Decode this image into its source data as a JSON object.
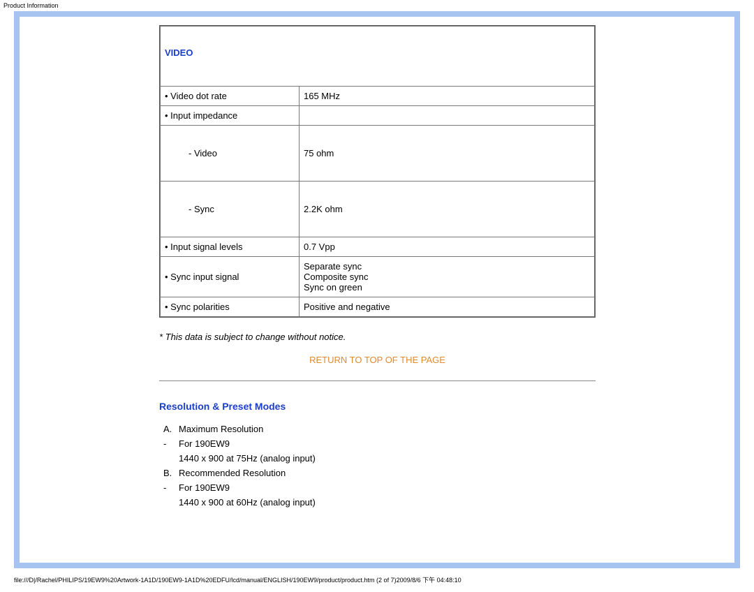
{
  "page": {
    "top_label": "Product Information",
    "footer_path": "file:///D|/Rachel/PHILIPS/19EW9%20Artwork-1A1D/190EW9-1A1D%20EDFU/lcd/manual/ENGLISH/190EW9/product/product.htm (2 of 7)2009/8/6 下午 04:48:10"
  },
  "video_section": {
    "heading": "VIDEO",
    "rows": {
      "dot_rate_label": "• Video dot rate",
      "dot_rate_value": "165 MHz",
      "impedance_label": "• Input impedance",
      "impedance_video_label": "- Video",
      "impedance_video_value": "75 ohm",
      "impedance_sync_label": "- Sync",
      "impedance_sync_value": "2.2K ohm",
      "signal_levels_label": "• Input signal levels",
      "signal_levels_value": "0.7 Vpp",
      "sync_input_label": "• Sync input signal",
      "sync_input_value_1": "Separate sync",
      "sync_input_value_2": "Composite sync",
      "sync_input_value_3": "Sync on green",
      "sync_polarities_label": "• Sync polarities",
      "sync_polarities_value": "Positive and negative"
    },
    "note": "* This data is subject to change without notice.",
    "return_link": "RETURN TO TOP OF THE PAGE"
  },
  "resolution_section": {
    "heading": "Resolution & Preset Modes",
    "items": {
      "a_marker": "A.",
      "a_label": "Maximum Resolution",
      "a_dash": "-",
      "a_for": "For 190EW9",
      "a_detail": "1440 x 900 at 75Hz (analog input)",
      "b_marker": "B.",
      "b_label": "Recommended Resolution",
      "b_dash": "-",
      "b_for": "For 190EW9",
      "b_detail": "1440 x 900 at 60Hz (analog input)"
    }
  }
}
